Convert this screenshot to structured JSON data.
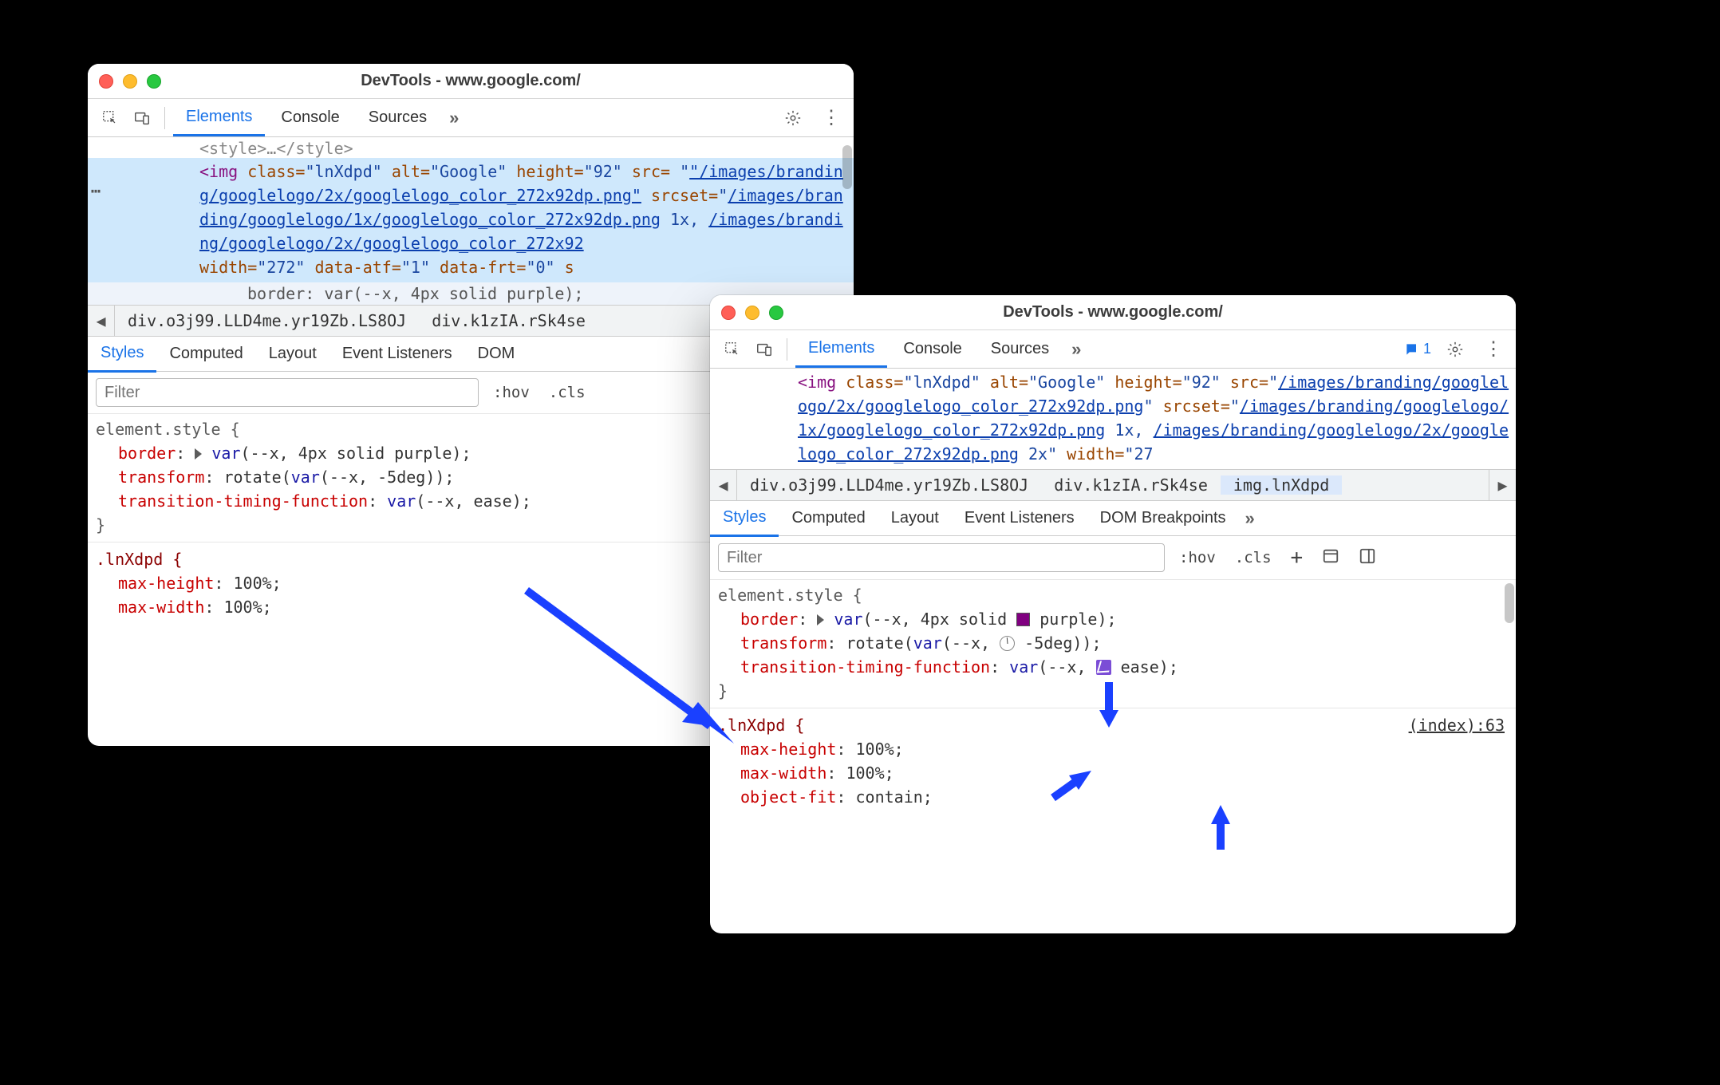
{
  "window_left": {
    "title": "DevTools - www.google.com/",
    "tabs": {
      "elements": "Elements",
      "console": "Console",
      "sources": "Sources"
    },
    "dom_top_fragment": "<style>…</style>",
    "dom_img_open": "<img",
    "dom_attrs": {
      "class_name": " class=",
      "class_val": "\"lnXdpd\"",
      "alt_name": " alt=",
      "alt_val": "\"Google\"",
      "height_name": " height=",
      "height_val": "\"92\"",
      "src_name": " src=",
      "src_val": "\"/images/branding/googlelogo/2x/googlelogo_color_272x92dp.png\"",
      "srcset_name": " srcset=",
      "srcset_val_pre": "\"",
      "srcset_link1": "/images/branding/googlelogo/1x/googlelogo_color_272x92dp.png",
      "srcset_mid1": " 1x, ",
      "srcset_link2": "/images/branding/googlelogo/2x/googlelogo_color_272x92",
      "width_name": "width=",
      "width_val": "\"272\"",
      "dataatf_name": " data-atf=",
      "dataatf_val": "\"1\"",
      "datafrt_name": " data-frt=",
      "datafrt_val": "\"0\"",
      "trailing": " s"
    },
    "pseudo_line": "border: var(--x, 4px solid purple);",
    "breadcrumb": {
      "crumb1": "div.o3j99.LLD4me.yr19Zb.LS8OJ",
      "crumb2": "div.k1zIA.rSk4se"
    },
    "subtabs": {
      "styles": "Styles",
      "computed": "Computed",
      "layout": "Layout",
      "listeners": "Event Listeners",
      "dom": "DOM "
    },
    "filter_placeholder": "Filter",
    "hov": ":hov",
    "cls": ".cls",
    "styles": {
      "rule1_sel": "element.style {",
      "r1p1n": "border",
      "r1p1v": ": ",
      "r1p1_var": "var",
      "r1p1_arg": "(--x, 4px solid purple)",
      "r1p1_end": ";",
      "r1p2n": "transform",
      "r1p2v": ": rotate(",
      "r1p2_var": "var",
      "r1p2_arg": "(--x, -5deg)",
      "r1p2_end": ");",
      "r1p3n": "transition-timing-function",
      "r1p3v": ": ",
      "r1p3_var": "var",
      "r1p3_arg": "(--x, ease)",
      "r1p3_end": ";",
      "rule1_close": "}",
      "rule2_sel": ".lnXdpd {",
      "r2p1n": "max-height",
      "r2p1v": ": 100%;",
      "r2p2n": "max-width",
      "r2p2v": ": 100%;"
    }
  },
  "window_right": {
    "title": "DevTools - www.google.com/",
    "tabs": {
      "elements": "Elements",
      "console": "Console",
      "sources": "Sources"
    },
    "issue_count": "1",
    "dom_img_open": "<img",
    "dom_attrs": {
      "class_name": " class=",
      "class_val": "\"lnXdpd\"",
      "alt_name": " alt=",
      "alt_val": "\"Google\"",
      "height_name": " height=",
      "height_val": "\"92\"",
      "src_name": " src=",
      "src_link": "/images/branding/googlelogo/2x/googlelogo_color_272x92dp.png",
      "srcset_name": " srcset=",
      "srcset_pre": "\"",
      "srcset_link1": "/images/branding/googlelogo/1x/googlelogo_color_272x92dp.png",
      "srcset_mid1": " 1x, ",
      "srcset_link2": "/images/branding/googlelogo/2x/googlelogo_color_272x92dp.png",
      "srcset_mid2": " 2x\"",
      "width_name": " width=",
      "width_val": "\"27"
    },
    "breadcrumb": {
      "crumb1": "div.o3j99.LLD4me.yr19Zb.LS8OJ",
      "crumb2": "div.k1zIA.rSk4se",
      "crumb3": "img.lnXdpd"
    },
    "subtabs": {
      "styles": "Styles",
      "computed": "Computed",
      "layout": "Layout",
      "listeners": "Event Listeners",
      "dom": "DOM Breakpoints"
    },
    "filter_placeholder": "Filter",
    "hov": ":hov",
    "cls": ".cls",
    "styles": {
      "rule1_sel": "element.style {",
      "r1p1n": "border",
      "r1p1v_a": ": ",
      "r1p1_var": "var",
      "r1p1_arg1": "(--x, 4px solid ",
      "r1p1_arg2": "purple)",
      "r1p1_end": ";",
      "r1p2n": "transform",
      "r1p2v_a": ": rotate(",
      "r1p2_var": "var",
      "r1p2_arg1": "(--x, ",
      "r1p2_arg2": "-5deg))",
      "r1p2_end": ";",
      "r1p3n": "transition-timing-function",
      "r1p3v_a": ": ",
      "r1p3_var": "var",
      "r1p3_arg1": "(--x, ",
      "r1p3_arg2": "ease)",
      "r1p3_end": ";",
      "rule1_close": "}",
      "rule2_sel": ".lnXdpd {",
      "srclink": "(index):63",
      "r2p1n": "max-height",
      "r2p1v": ": 100%;",
      "r2p2n": "max-width",
      "r2p2v": ": 100%;",
      "r2p3n": "object-fit",
      "r2p3v": ": contain;"
    }
  }
}
